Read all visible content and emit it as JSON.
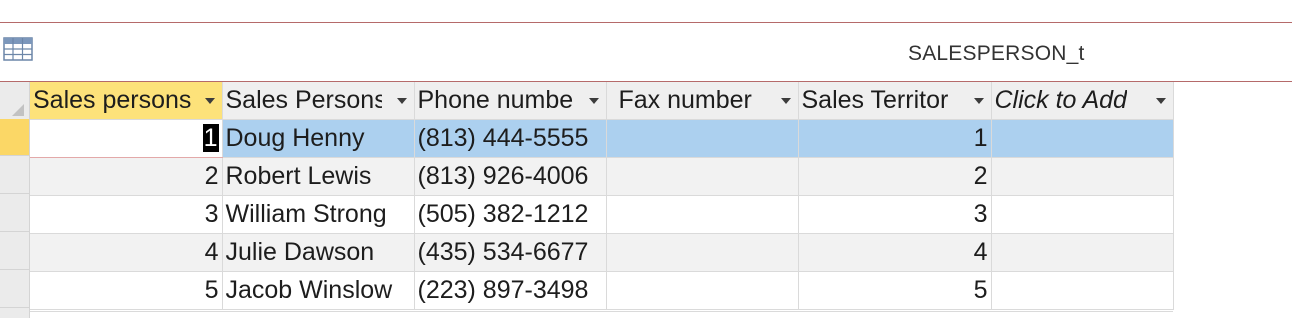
{
  "tab": {
    "title": "SALESPERSON_t",
    "icon": "datasheet-table-icon"
  },
  "columns": [
    {
      "label": "Sales persons",
      "name": "col-sales-person-id"
    },
    {
      "label": "Sales Persons",
      "name": "col-sales-person-name"
    },
    {
      "label": "Phone numbe",
      "name": "col-phone-number"
    },
    {
      "label": "Fax number",
      "name": "col-fax-number"
    },
    {
      "label": "Sales Territor",
      "name": "col-sales-territory"
    },
    {
      "label": "Click to Add",
      "name": "col-click-to-add"
    }
  ],
  "rows": [
    {
      "id": "1",
      "name": "Doug Henny",
      "phone": "(813) 444-5555",
      "fax": "",
      "territory": "1"
    },
    {
      "id": "2",
      "name": "Robert Lewis",
      "phone": "(813) 926-4006",
      "fax": "",
      "territory": "2"
    },
    {
      "id": "3",
      "name": "William Strong",
      "phone": "(505) 382-1212",
      "fax": "",
      "territory": "3"
    },
    {
      "id": "4",
      "name": "Julie Dawson",
      "phone": "(435) 534-6677",
      "fax": "",
      "territory": "4"
    },
    {
      "id": "5",
      "name": "Jacob Winslow",
      "phone": "(223) 897-3498",
      "fax": "",
      "territory": "5"
    }
  ],
  "colors": {
    "active_header": "#fde27a",
    "selected_row": "#acd0ef",
    "current_selector": "#fbd766",
    "tab_border": "#b56a6a"
  }
}
